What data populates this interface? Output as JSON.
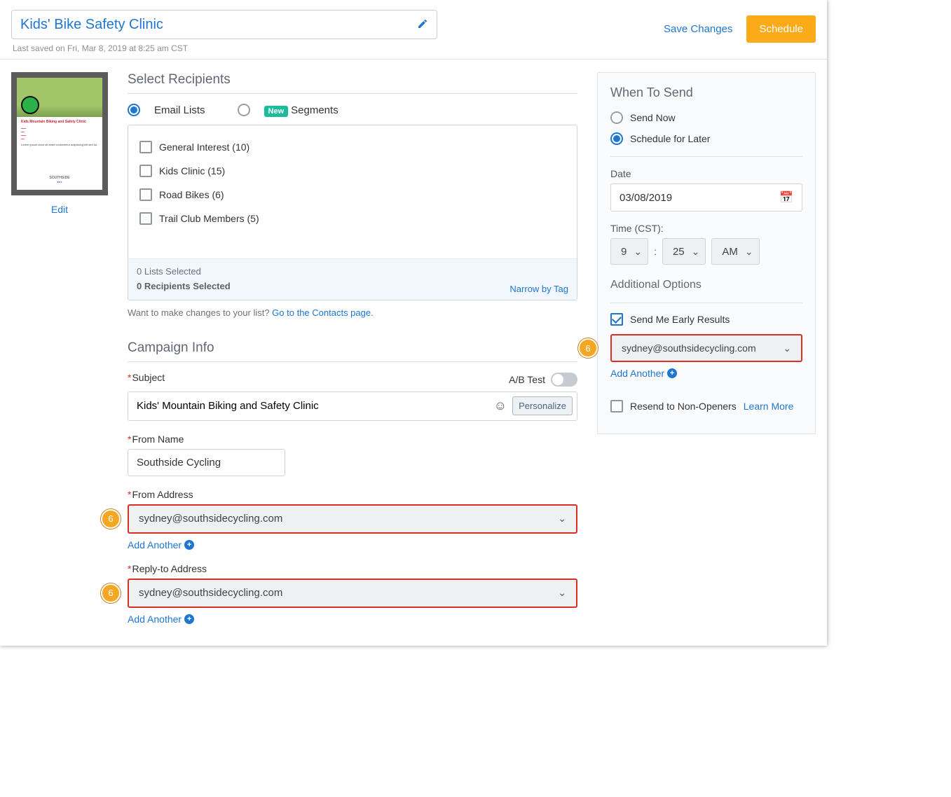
{
  "header": {
    "title": "Kids' Bike Safety Clinic",
    "last_saved": "Last saved on Fri, Mar 8, 2019 at 8:25 am CST",
    "save_label": "Save Changes",
    "schedule_label": "Schedule"
  },
  "preview": {
    "edit_label": "Edit",
    "headline": "Kids Mountain Biking and Safety Clinic"
  },
  "recipients": {
    "heading": "Select Recipients",
    "email_lists_label": "Email Lists",
    "segments_label": "Segments",
    "new_badge": "New",
    "lists": [
      {
        "label": "General Interest (10)"
      },
      {
        "label": "Kids Clinic (15)"
      },
      {
        "label": "Road Bikes (6)"
      },
      {
        "label": "Trail Club Members (5)"
      }
    ],
    "lists_selected": "0 Lists Selected",
    "recipients_selected": "0 Recipients Selected",
    "narrow_label": "Narrow by Tag",
    "hint_prefix": "Want to make changes to your list? ",
    "hint_link": "Go to the Contacts page."
  },
  "campaign": {
    "heading": "Campaign Info",
    "subject_label": "Subject",
    "ab_label": "A/B Test",
    "subject_value": "Kids' Mountain Biking and Safety Clinic",
    "personalize_label": "Personalize",
    "from_name_label": "From Name",
    "from_name_value": "Southside Cycling",
    "from_address_label": "From Address",
    "from_address_value": "sydney@southsidecycling.com",
    "reply_to_label": "Reply-to Address",
    "reply_to_value": "sydney@southsidecycling.com",
    "add_another_label": "Add Another",
    "badge_6": "6"
  },
  "when": {
    "heading": "When To Send",
    "send_now_label": "Send Now",
    "schedule_later_label": "Schedule for Later",
    "date_label": "Date",
    "date_value": "03/08/2019",
    "time_label": "Time (CST):",
    "hour": "9",
    "minute": "25",
    "ampm": "AM",
    "additional_heading": "Additional Options",
    "early_results_label": "Send Me Early Results",
    "early_results_email": "sydney@southsidecycling.com",
    "add_another_label": "Add Another",
    "resend_label": "Resend to Non-Openers",
    "learn_more_label": "Learn More",
    "badge_6": "6"
  }
}
